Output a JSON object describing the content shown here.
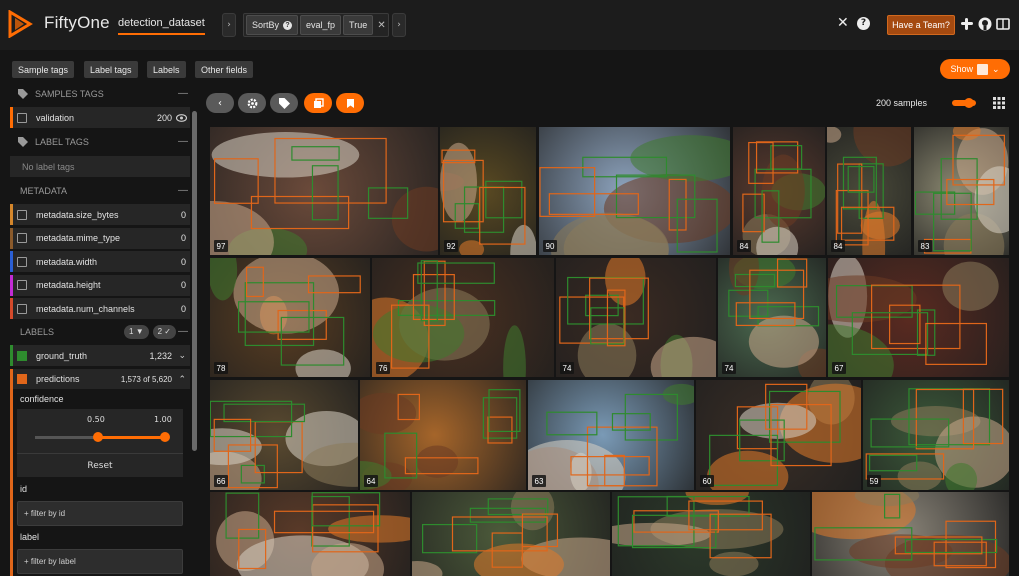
{
  "header": {
    "app_name": "FiftyOne",
    "dataset": "detection_dataset",
    "view_bar": {
      "stage": "SortBy",
      "field": "eval_fp",
      "reverse": "True"
    },
    "team_button": "Have a Team?"
  },
  "tabs": [
    "Sample tags",
    "Label tags",
    "Labels",
    "Other fields"
  ],
  "show_button": "Show",
  "sidebar": {
    "samples_tags_header": "SAMPLES TAGS",
    "validation_label": "validation",
    "validation_count": "200",
    "label_tags_header": "LABEL TAGS",
    "no_label_tags": "No label tags",
    "metadata_header": "METADATA",
    "metadata_fields": [
      {
        "label": "metadata.size_bytes",
        "count": "0",
        "color": "#d4862b"
      },
      {
        "label": "metadata.mime_type",
        "count": "0",
        "color": "#8a5a2b"
      },
      {
        "label": "metadata.width",
        "count": "0",
        "color": "#2b5fd4"
      },
      {
        "label": "metadata.height",
        "count": "0",
        "color": "#c22bd4"
      },
      {
        "label": "metadata.num_channels",
        "count": "0",
        "color": "#d44a2b"
      }
    ],
    "labels_header": "LABELS",
    "labels_badge_1": "1",
    "labels_badge_2": "2",
    "ground_truth_label": "ground_truth",
    "ground_truth_count": "1,232",
    "predictions_label": "predictions",
    "predictions_count": "1,573 of 5,620",
    "confidence_label": "confidence",
    "slider_min": "0.50",
    "slider_max": "1.00",
    "reset_label": "Reset",
    "id_label": "id",
    "id_placeholder": "+ filter by id",
    "label_label": "label",
    "label_placeholder": "+ filter by label",
    "colors": {
      "ground_truth": "#2e8b2e",
      "predictions": "#e0661a"
    }
  },
  "grid": {
    "samples_label": "200 samples",
    "accent": "#ff6d04",
    "tiles": [
      {
        "num": "97",
        "bg": "#6b4a3a"
      },
      {
        "num": "92",
        "bg": "#5a4a22"
      },
      {
        "num": "90",
        "bg": "#8da3bd"
      },
      {
        "num": "84",
        "bg": "#5a3a2e"
      },
      {
        "num": "84",
        "bg": "#4a4a3a"
      },
      {
        "num": "83",
        "bg": "#8d8a72"
      },
      {
        "num": "78",
        "bg": "#5a3e22"
      },
      {
        "num": "76",
        "bg": "#4a3020"
      },
      {
        "num": "74",
        "bg": "#3a2a22"
      },
      {
        "num": "74",
        "bg": "#4c6b50"
      },
      {
        "num": "67",
        "bg": "#5a2a20"
      },
      {
        "num": "66",
        "bg": "#5a4a30"
      },
      {
        "num": "64",
        "bg": "#a5652a"
      },
      {
        "num": "63",
        "bg": "#7a9ab6"
      },
      {
        "num": "60",
        "bg": "#3a2e26"
      },
      {
        "num": "59",
        "bg": "#3c5a3a"
      },
      {
        "num": "",
        "bg": "#5a3a28"
      },
      {
        "num": "",
        "bg": "#4c5a3a"
      },
      {
        "num": "",
        "bg": "#2c3a2a"
      },
      {
        "num": "",
        "bg": "#8a8478"
      }
    ]
  }
}
